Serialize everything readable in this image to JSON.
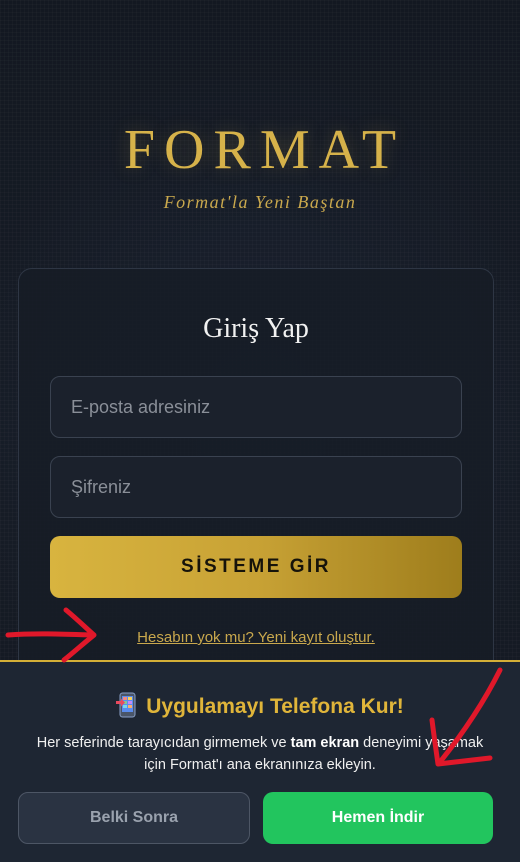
{
  "brand": {
    "title": "FORMAT",
    "tagline": "Format'la Yeni Baştan"
  },
  "login": {
    "title": "Giriş Yap",
    "email_placeholder": "E-posta adresiniz",
    "password_placeholder": "Şifreniz",
    "submit_label": "SİSTEME GİR",
    "register_link": "Hesabın yok mu? Yeni kayıt oluştur."
  },
  "install_banner": {
    "title": "Uygulamayı Telefona Kur!",
    "desc_part1": "Her seferinde tarayıcıdan girmemek ve ",
    "desc_bold": "tam ekran",
    "desc_part2": " deneyimi yaşamak için Format'ı ana ekranınıza ekleyin.",
    "later_label": "Belki Sonra",
    "download_label": "Hemen İndir",
    "icon": "mobile-install-icon"
  },
  "colors": {
    "gold": "#d4af37",
    "green": "#22c55e",
    "annotation_red": "#e0182a"
  }
}
